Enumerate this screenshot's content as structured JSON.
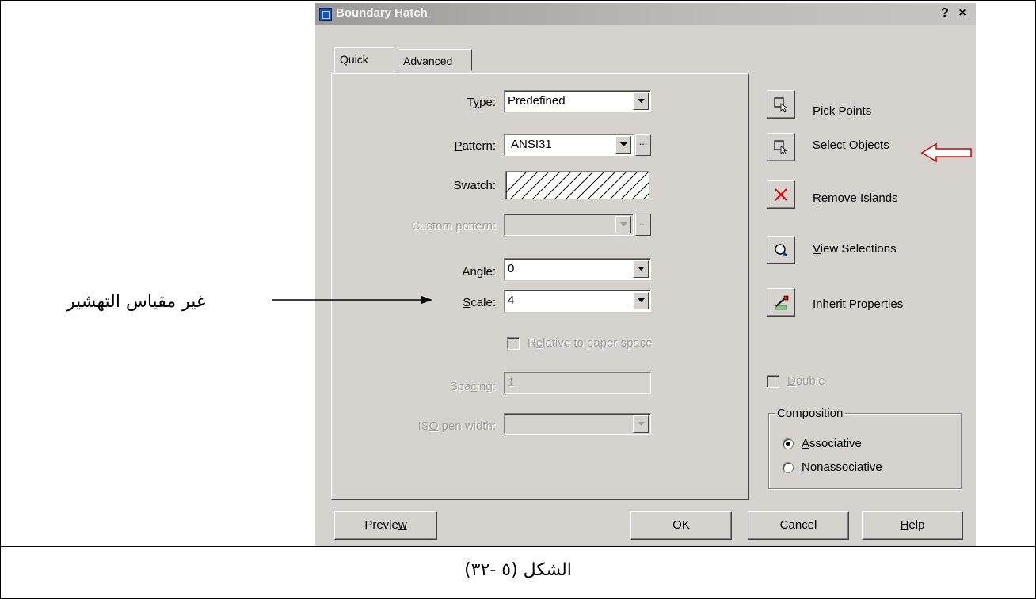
{
  "dialog": {
    "title": "Boundary Hatch",
    "help_glyph": "?",
    "close_glyph": "×",
    "icon": "app-icon"
  },
  "tabs": [
    {
      "label": "Quick",
      "active": true
    },
    {
      "label": "Advanced",
      "active": false
    }
  ],
  "form": {
    "type": {
      "label_pre": "T",
      "label_u": "y",
      "label_post": "pe:",
      "value": "Predefined"
    },
    "pattern": {
      "label_pre": "",
      "label_u": "P",
      "label_post": "attern:",
      "value": "ANSI31",
      "browse_label": "..."
    },
    "swatch": {
      "label": "Swatch:"
    },
    "custom_pattern": {
      "label": "Custom pattern:",
      "value": "",
      "browse_label": "..."
    },
    "angle": {
      "label_pre": "An",
      "label_u": "g",
      "label_post": "le:",
      "value": "0"
    },
    "scale": {
      "label_pre": "",
      "label_u": "S",
      "label_post": "cale:",
      "value": "4"
    },
    "relative": {
      "label_pre": "R",
      "label_u": "e",
      "label_post": "lative to paper space",
      "checked": false
    },
    "spacing": {
      "label_pre": "Spa",
      "label_u": "c",
      "label_post": "ing:",
      "value": "1"
    },
    "iso_pen": {
      "label_pre": "IS",
      "label_u": "O",
      "label_post": " pen width:",
      "value": ""
    }
  },
  "side": {
    "pick_points": {
      "pre": "Pic",
      "u": "k",
      "post": " Points",
      "icon": "pick-points-icon"
    },
    "select_objects": {
      "pre": "Select O",
      "u": "b",
      "post": "jects",
      "icon": "select-objects-icon"
    },
    "remove_islands": {
      "pre": "",
      "u": "R",
      "post": "emove Islands",
      "icon": "remove-islands-icon"
    },
    "view_selections": {
      "pre": "",
      "u": "V",
      "post": "iew Selections",
      "icon": "view-selections-icon"
    },
    "inherit_properties": {
      "pre": "",
      "u": "I",
      "post": "nherit Properties",
      "icon": "inherit-properties-icon"
    },
    "double": {
      "pre": "",
      "u": "D",
      "post": "ouble",
      "checked": false
    },
    "composition": {
      "title": "Composition",
      "options": [
        {
          "pre": "",
          "u": "A",
          "post": "ssociative",
          "checked": true
        },
        {
          "pre": "",
          "u": "N",
          "post": "onassociative",
          "checked": false
        }
      ]
    }
  },
  "buttons": {
    "preview": {
      "pre": "Previe",
      "u": "w",
      "post": ""
    },
    "ok": "OK",
    "cancel": "Cancel",
    "help": {
      "pre": "",
      "u": "H",
      "post": "elp"
    }
  },
  "annotations": {
    "scale_note": "غير مقياس التهشير",
    "caption": "الشكل (٥ -٣٢)"
  },
  "colors": {
    "dialog_bg": "#d6d3ce",
    "arrow_red": "#d00000",
    "remove_x_red": "#e00000"
  }
}
